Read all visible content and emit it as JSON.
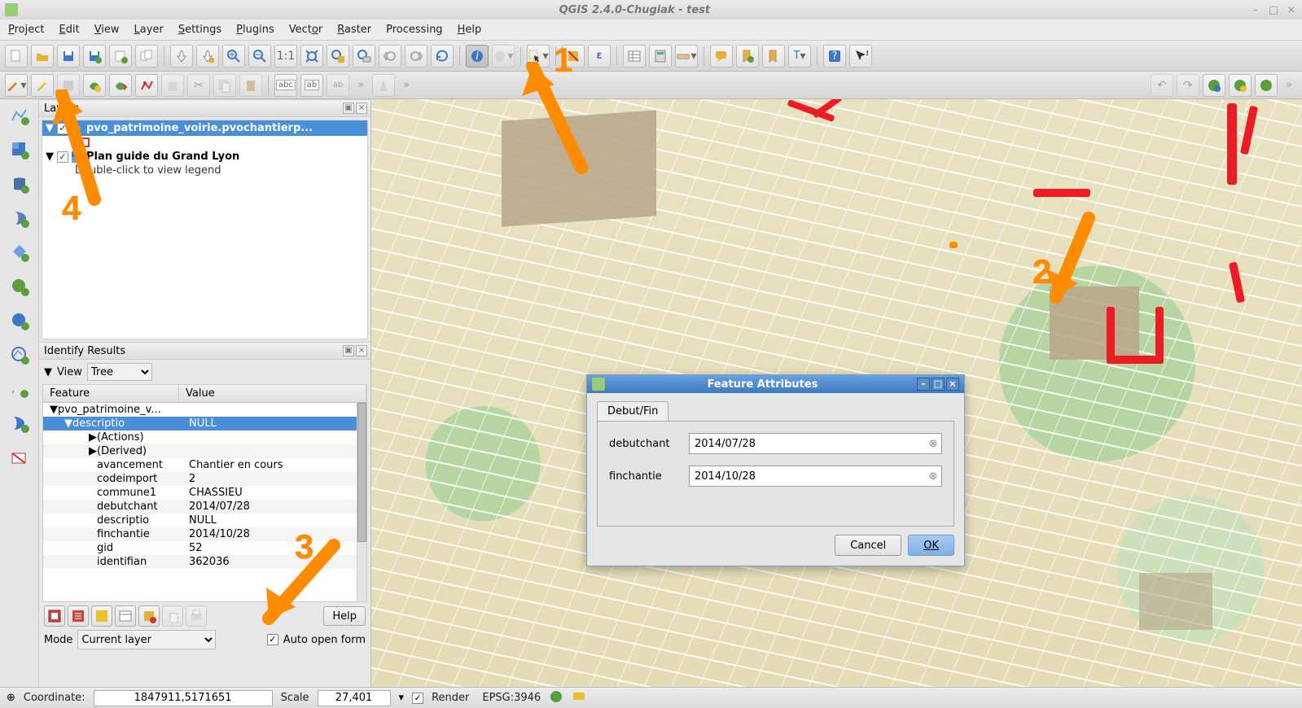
{
  "window": {
    "title": "QGIS 2.4.0-Chugiak - test"
  },
  "menu": {
    "project": "Project",
    "edit": "Edit",
    "view": "View",
    "layer": "Layer",
    "settings": "Settings",
    "plugins": "Plugins",
    "vector": "Vector",
    "raster": "Raster",
    "processing": "Processing",
    "help": "Help"
  },
  "layers_panel": {
    "title": "Layers",
    "layer1": "pvo_patrimoine_voirie.pvochantierp...",
    "layer2": "Plan guide du Grand Lyon",
    "layer2_hint": "Double-click to view legend"
  },
  "identify_panel": {
    "title": "Identify Results",
    "view_label": "View",
    "view_mode": "Tree",
    "col_feature": "Feature",
    "col_value": "Value",
    "rows": [
      {
        "f": "pvo_patrimoine_v...",
        "v": "",
        "lvl": 0,
        "tri": "▼"
      },
      {
        "f": "descriptio",
        "v": "NULL",
        "lvl": 1,
        "tri": "▼",
        "sel": true
      },
      {
        "f": "(Actions)",
        "v": "",
        "lvl": 2,
        "tri": "▶"
      },
      {
        "f": "(Derived)",
        "v": "",
        "lvl": 2,
        "tri": "▶"
      },
      {
        "f": "avancement",
        "v": "Chantier en cours",
        "lvl": 2
      },
      {
        "f": "codeimport",
        "v": "2",
        "lvl": 2
      },
      {
        "f": "commune1",
        "v": "CHASSIEU",
        "lvl": 2
      },
      {
        "f": "debutchant",
        "v": "2014/07/28",
        "lvl": 2
      },
      {
        "f": "descriptio",
        "v": "NULL",
        "lvl": 2
      },
      {
        "f": "finchantie",
        "v": "2014/10/28",
        "lvl": 2
      },
      {
        "f": "gid",
        "v": "52",
        "lvl": 2
      },
      {
        "f": "identifian",
        "v": "362036",
        "lvl": 2
      }
    ],
    "help": "Help",
    "mode_label": "Mode",
    "mode_value": "Current layer",
    "auto_open": "Auto open form"
  },
  "dialog": {
    "title": "Feature Attributes",
    "tab": "Debut/Fin",
    "field1_label": "debutchant",
    "field1_value": "2014/07/28",
    "field2_label": "finchantie",
    "field2_value": "2014/10/28",
    "cancel": "Cancel",
    "ok": "OK"
  },
  "statusbar": {
    "coord_label": "Coordinate:",
    "coord_value": "1847911,5171651",
    "scale_label": "Scale",
    "scale_value": "27,401",
    "render": "Render",
    "epsg": "EPSG:3946"
  },
  "annotations": {
    "n1": "1",
    "n2": "2",
    "n3": "3",
    "n4": "4"
  }
}
